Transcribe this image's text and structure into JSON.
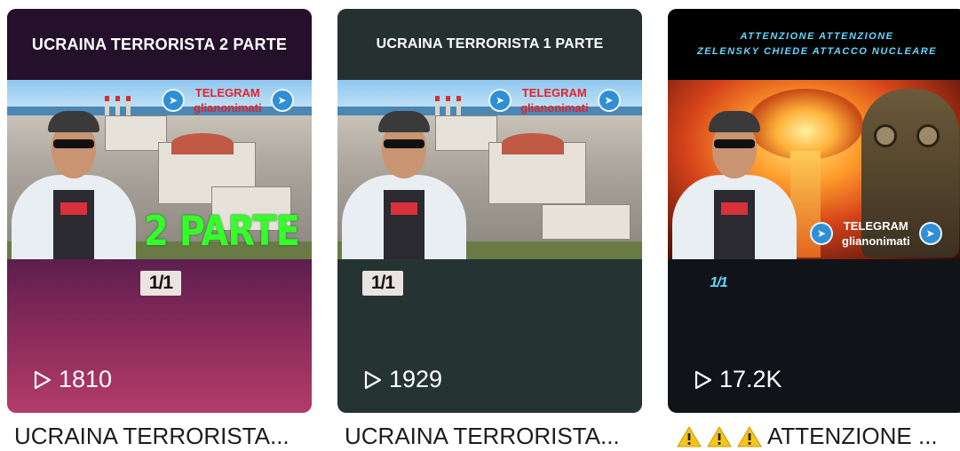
{
  "cards": [
    {
      "title": "UCRAINA TERRORISTA 2 PARTE",
      "telegram_label": "TELEGRAM",
      "telegram_handle": "glianonimati",
      "overlay_text": "2 PARTE",
      "badge": "1/1",
      "views": "1810",
      "caption": "UCRAINA TERRORISTA..."
    },
    {
      "title": "UCRAINA TERRORISTA 1 PARTE",
      "telegram_label": "TELEGRAM",
      "telegram_handle": "glianonimati",
      "badge": "1/1",
      "views": "1929",
      "caption": "UCRAINA TERRORISTA..."
    },
    {
      "title_line1": "ATTENZIONE ATTENZIONE",
      "title_line2": "ZELENSKY CHIEDE ATTACCO NUCLEARE",
      "telegram_label": "TELEGRAM",
      "telegram_handle": "glianonimati",
      "badge": "1/1",
      "views": "17.2K",
      "caption": "ATTENZIONE ..."
    }
  ],
  "icons": {
    "play": "play-icon",
    "telegram": "telegram-icon",
    "warning": "warning-icon"
  },
  "colors": {
    "telegram_blue": "#2e8fd6",
    "overlay_green": "#35ff2b",
    "title_cyan": "#62d8ff",
    "warning_yellow": "#f5c518"
  }
}
